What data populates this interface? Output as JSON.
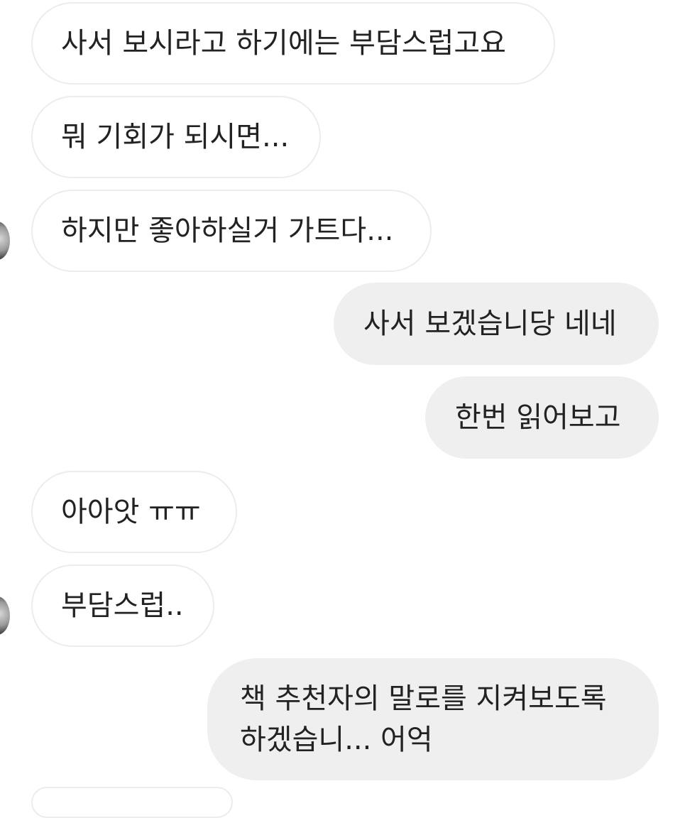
{
  "messages": [
    {
      "id": "m1",
      "side": "incoming",
      "text": "사서 보시라고 하기에는 부담스럽고요"
    },
    {
      "id": "m2",
      "side": "incoming",
      "text": "뭐 기회가 되시면..."
    },
    {
      "id": "m3",
      "side": "incoming",
      "text": "하지만 좋아하실거 가트다..."
    },
    {
      "id": "m4",
      "side": "outgoing",
      "text": "사서 보겠습니당 네네"
    },
    {
      "id": "m5",
      "side": "outgoing",
      "text": "한번 읽어보고"
    },
    {
      "id": "m6",
      "side": "incoming",
      "text": "아아앗 ㅠㅠ"
    },
    {
      "id": "m7",
      "side": "incoming",
      "text": "부담스럽.."
    },
    {
      "id": "m8",
      "side": "outgoing",
      "lines": [
        "책 추천자의 말로를 지켜보도록",
        "하겠습니... 어억"
      ]
    }
  ],
  "colors": {
    "incoming_bg": "#ffffff",
    "incoming_border": "#ececec",
    "outgoing_bg": "#efefef",
    "text": "#222222"
  }
}
